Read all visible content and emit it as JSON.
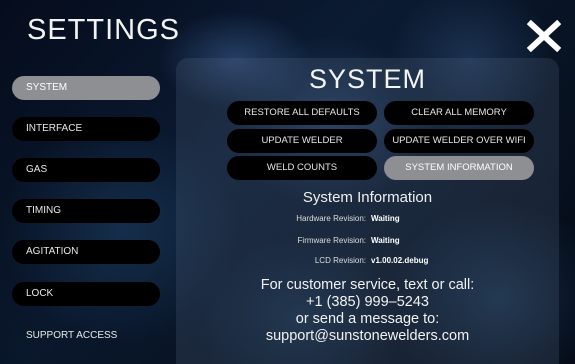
{
  "header": {
    "title": "SETTINGS"
  },
  "sidebar": {
    "items": [
      {
        "label": "SYSTEM",
        "active": true
      },
      {
        "label": "INTERFACE",
        "active": false
      },
      {
        "label": "GAS",
        "active": false
      },
      {
        "label": "TIMING",
        "active": false
      },
      {
        "label": "AGITATION",
        "active": false
      },
      {
        "label": "LOCK",
        "active": false
      }
    ],
    "support_label": "SUPPORT ACCESS"
  },
  "panel": {
    "title": "SYSTEM",
    "buttons": {
      "restore": "RESTORE ALL DEFAULTS",
      "clear": "CLEAR ALL MEMORY",
      "update": "UPDATE WELDER",
      "update_wifi": "UPDATE WELDER OVER WIFI",
      "weld_counts": "WELD COUNTS",
      "system_info": "SYSTEM INFORMATION"
    },
    "info": {
      "title": "System Information",
      "hardware_label": "Hardware Revision:",
      "hardware_value": "Waiting",
      "firmware_label": "Firmware Revision:",
      "firmware_value": "Waiting",
      "lcd_label": "LCD Revision:",
      "lcd_value": "v1.00.02.debug"
    },
    "contact": {
      "line1": "For customer service, text or call:",
      "phone": "+1 (385) 999–5243",
      "line3": "or send a message to:",
      "email": "support@sunstonewelders.com"
    }
  },
  "colors": {
    "active_button": "#8e8f93",
    "button": "#000000",
    "text": "#ffffff"
  },
  "icons": {
    "close": "close-x-icon"
  }
}
